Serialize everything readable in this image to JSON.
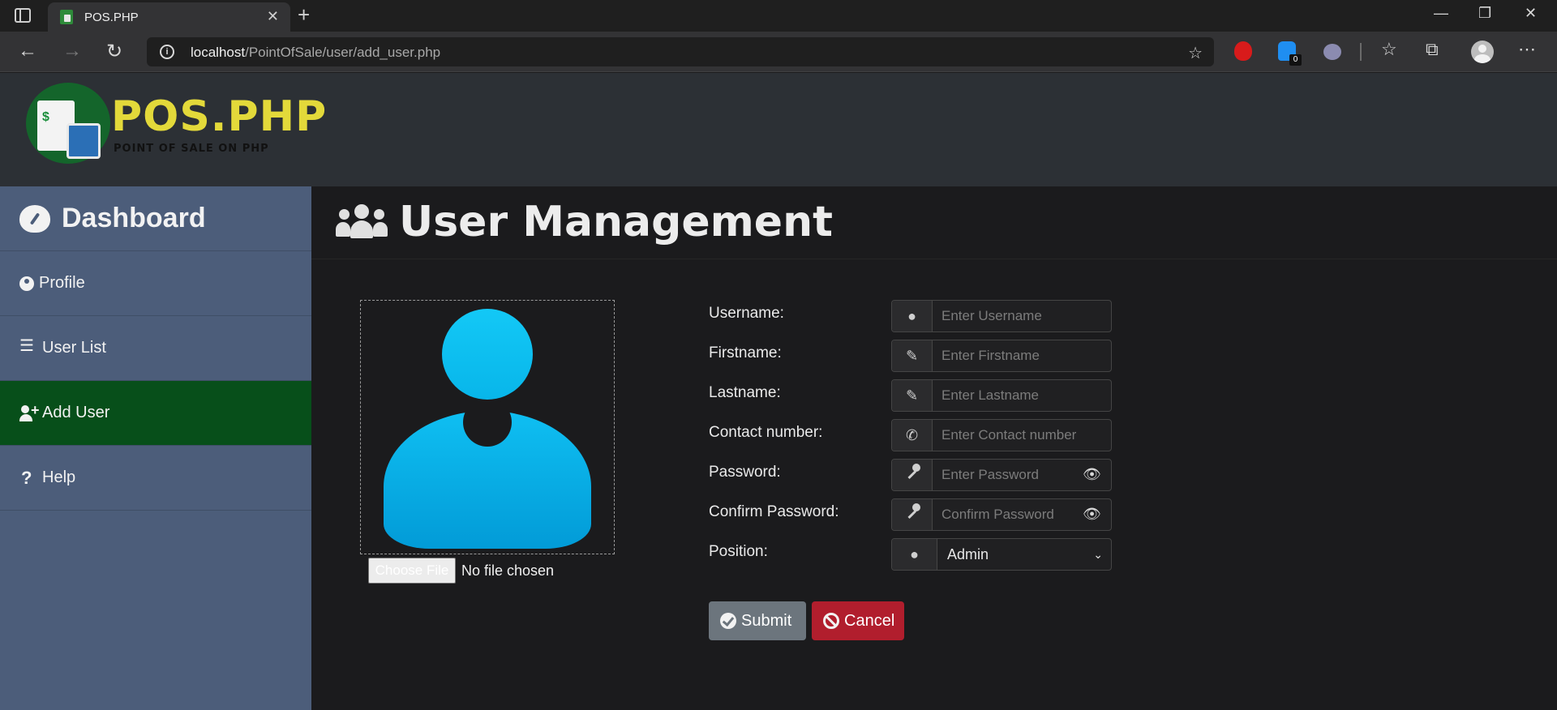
{
  "browser": {
    "tab_title": "POS.PHP",
    "tab_close": "✕",
    "new_tab": "+",
    "url_host": "localhost",
    "url_path": "/PointOfSale/user/add_user.php",
    "extension_badge": "0",
    "window_minimize": "—",
    "window_restore": "❐",
    "window_close": "✕"
  },
  "site": {
    "logo_title": "POS.PHP",
    "logo_subtitle": "POINT OF SALE ON PHP"
  },
  "sidebar": {
    "items": [
      {
        "label": "Dashboard",
        "icon": "gauge-icon"
      },
      {
        "label": "Profile",
        "icon": "user-circle-icon"
      },
      {
        "label": "User List",
        "icon": "list-icon"
      },
      {
        "label": "Add User",
        "icon": "user-plus-icon",
        "active": true
      },
      {
        "label": "Help",
        "icon": "question-icon"
      }
    ]
  },
  "main": {
    "title": "User Management",
    "photo": {
      "file_button": "Choose File",
      "file_status": "No file chosen"
    },
    "form": {
      "username": {
        "label": "Username:",
        "placeholder": "Enter Username"
      },
      "firstname": {
        "label": "Firstname:",
        "placeholder": "Enter Firstname"
      },
      "lastname": {
        "label": "Lastname:",
        "placeholder": "Enter Lastname"
      },
      "contact": {
        "label": "Contact number:",
        "placeholder": "Enter Contact number"
      },
      "password": {
        "label": "Password:",
        "placeholder": "Enter Password"
      },
      "confirm_password": {
        "label": "Confirm Password:",
        "placeholder": "Confirm Password"
      },
      "position": {
        "label": "Position:",
        "value": "Admin"
      }
    },
    "buttons": {
      "submit": "Submit",
      "cancel": "Cancel"
    }
  },
  "colors": {
    "sidebar": "#4c5d7a",
    "sidebar_active": "#074f1a",
    "submit": "#6c757d",
    "cancel": "#b11e2d",
    "header": "#2c3035"
  }
}
